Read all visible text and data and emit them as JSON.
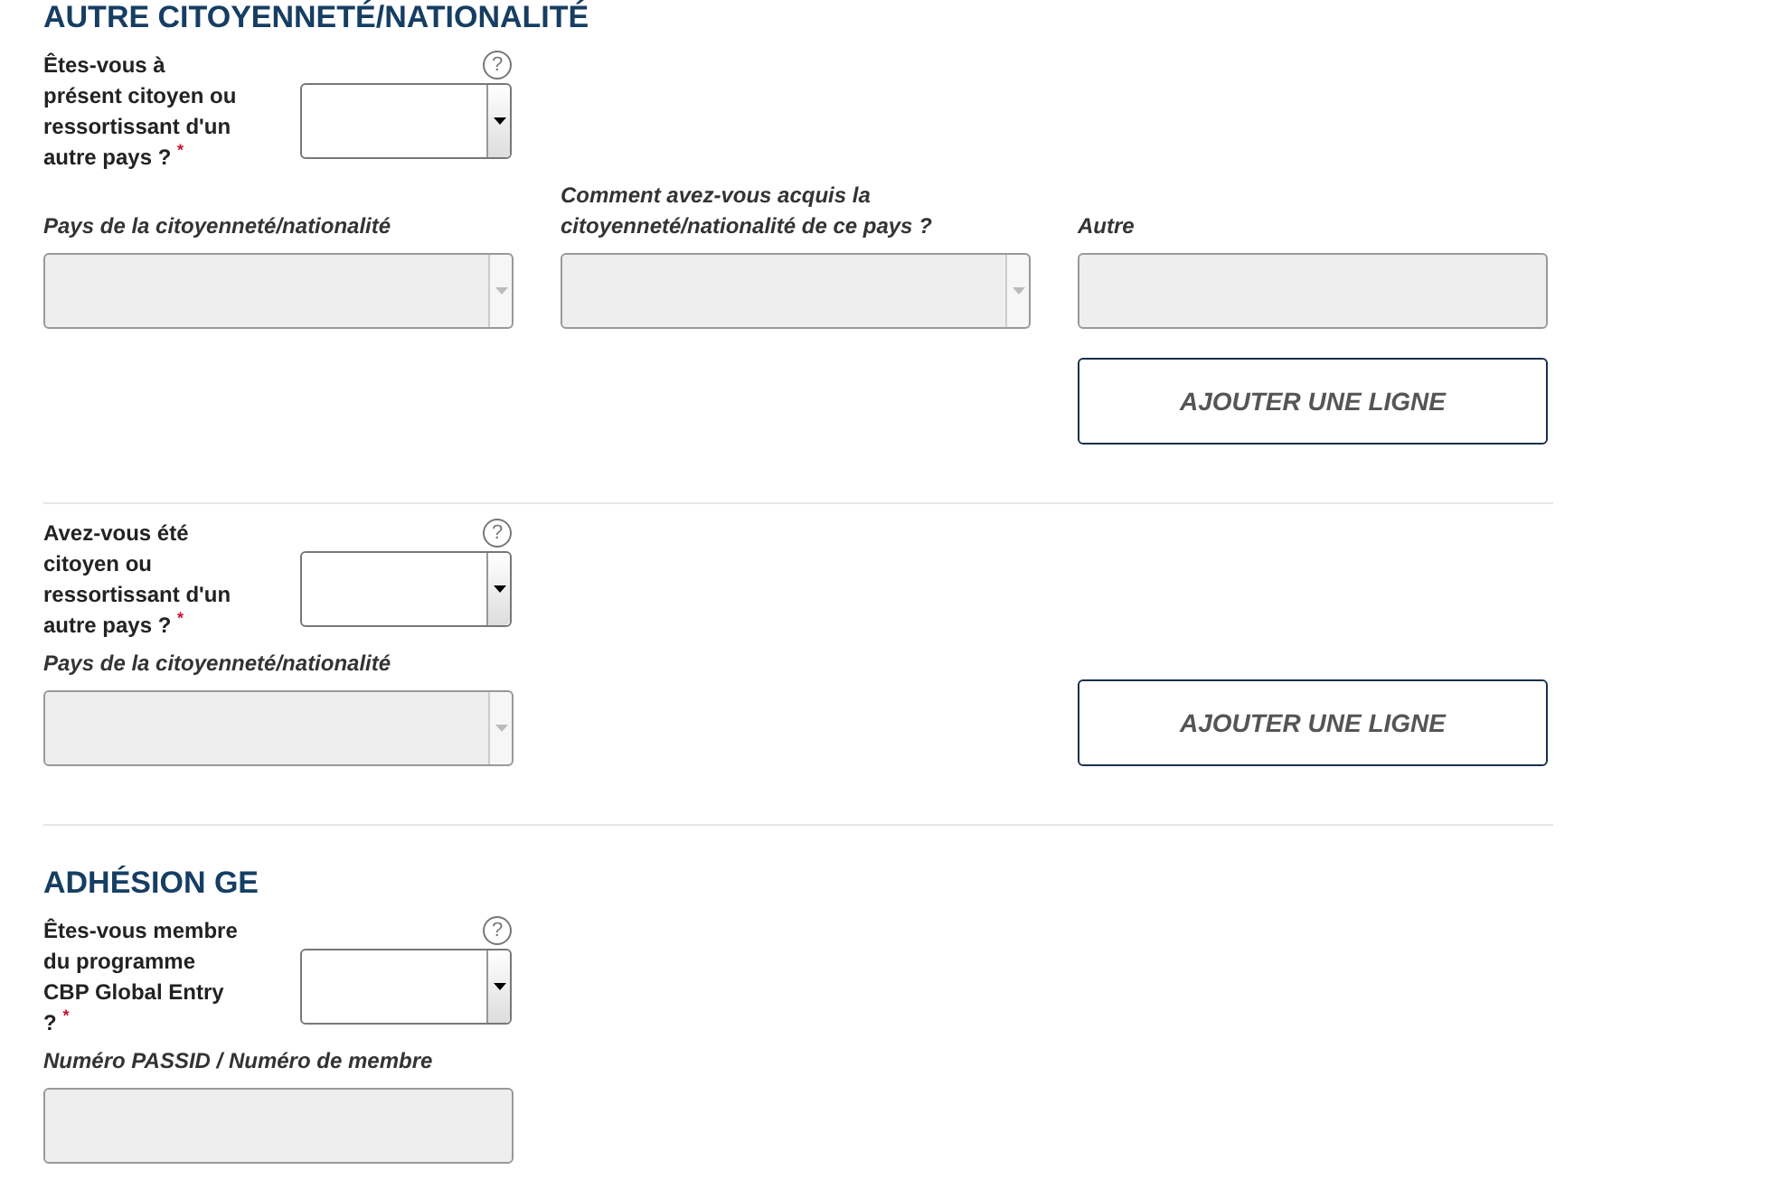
{
  "sections": [
    {
      "heading": "AUTRE CITOYENNETÉ/NATIONALITÉ",
      "question": {
        "label": "Êtes-vous à présent citoyen ou ressortissant d'un autre pays ?",
        "required": "*",
        "help": "?"
      },
      "fields": [
        {
          "kind": "select",
          "label": "Pays de la citoyenneté/nationalité",
          "disabled": true
        },
        {
          "kind": "select",
          "label": "Comment avez-vous acquis la citoyenneté/nationalité de ce pays ?",
          "disabled": true
        },
        {
          "kind": "text",
          "label": "Autre",
          "disabled": true
        },
        {
          "kind": "button",
          "label": "AJOUTER UNE LIGNE"
        }
      ]
    },
    {
      "question": {
        "label": "Avez-vous été citoyen ou ressortissant d'un autre pays ?",
        "required": "*",
        "help": "?"
      },
      "fields": [
        {
          "kind": "select",
          "label": "Pays de la citoyenneté/nationalité",
          "disabled": true
        },
        {
          "kind": "button",
          "label": "AJOUTER UNE LIGNE"
        }
      ]
    },
    {
      "heading": "ADHÉSION GE",
      "question": {
        "label": "Êtes-vous membre du programme CBP Global Entry ?",
        "required": "*",
        "help": "?"
      },
      "fields": [
        {
          "kind": "text",
          "label": "Numéro PASSID / Numéro de membre",
          "disabled": true
        }
      ]
    }
  ]
}
